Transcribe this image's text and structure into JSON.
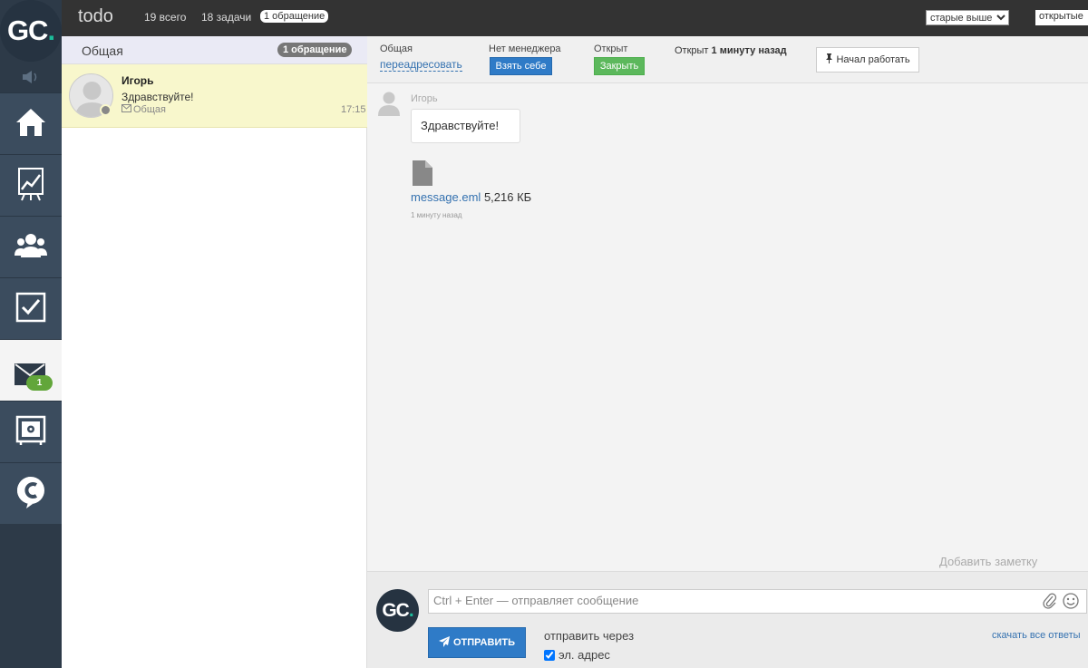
{
  "logo": {
    "text": "GC",
    "dot": "."
  },
  "topbar": {
    "title": "todo",
    "total": "19 всего",
    "tasks": "18 задачи",
    "tickets_pill": "1 обращение",
    "sort_selected": "старые выше",
    "filter_selected": "открытые"
  },
  "nav": {
    "items": [
      "home",
      "chart",
      "users",
      "tasks",
      "mail",
      "safe",
      "chat"
    ],
    "mail_badge": "1"
  },
  "list": {
    "header_label": "Общая",
    "header_count": "1 обращение",
    "items": [
      {
        "name": "Игорь",
        "message": "Здравствуйте!",
        "dept": "Общая",
        "time": "17:15"
      }
    ]
  },
  "ticket": {
    "dept_label": "Общая",
    "redirect_label": "переадресовать",
    "manager_label": "Нет менеджера",
    "take_button": "Взять себе",
    "status_label": "Открыт",
    "close_button": "Закрыть",
    "opened_prefix": "Открыт",
    "opened_time": "1 минуту назад",
    "start_work_button": "Начал работать"
  },
  "conversation": {
    "sender": "Игорь",
    "message": "Здравствуйте!",
    "attachment_name": "message.eml",
    "attachment_size": "5,216 КБ",
    "timestamp": "1 минуту назад",
    "add_note": "Добавить заметку"
  },
  "reply": {
    "placeholder": "Ctrl + Enter — отправляет сообщение",
    "send_button": "ОТПРАВИТЬ",
    "send_via_label": "отправить через",
    "email_option": "эл. адрес",
    "email_checked": true,
    "download_all": "скачать все ответы"
  },
  "colors": {
    "nav_bg": "#2d3a48",
    "nav_item_bg": "#3b4c5e",
    "accent_blue": "#2f7bc7",
    "accent_green": "#5cb85c",
    "badge_green": "#62a63a",
    "logo_dot": "#1bbd9b",
    "selected_item_bg": "#f8f7cc"
  }
}
